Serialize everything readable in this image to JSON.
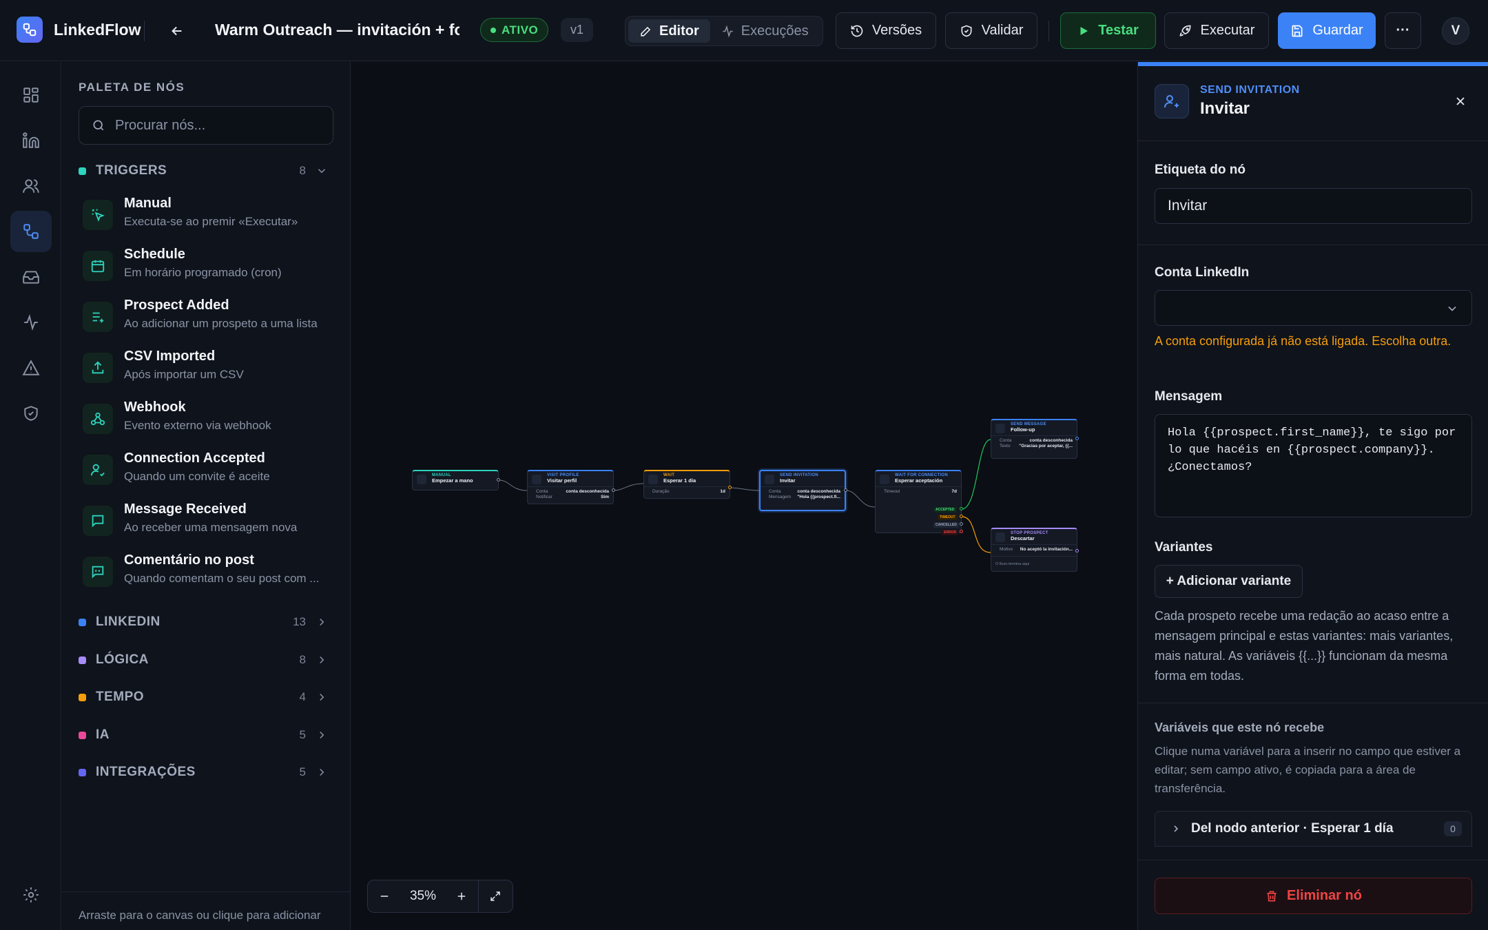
{
  "app": {
    "name": "LinkedFlow"
  },
  "workflow": {
    "title": "Warm Outreach — invitación + follow-up",
    "status": "ATIVO",
    "version": "v1"
  },
  "tabs": [
    {
      "label": "Editor"
    },
    {
      "label": "Execuções"
    }
  ],
  "toolbar": {
    "versions": "Versões",
    "validate": "Validar",
    "test": "Testar",
    "run": "Executar",
    "save": "Guardar",
    "more": "···",
    "avatar": "V"
  },
  "palette": {
    "title": "PALETA DE NÓS",
    "search_placeholder": "Procurar nós...",
    "footer": "Arraste para o canvas ou clique para adicionar",
    "categories": [
      {
        "name": "TRIGGERS",
        "count": "8",
        "color": "#2dd4bf"
      },
      {
        "name": "LINKEDIN",
        "count": "13",
        "color": "#3b82f6"
      },
      {
        "name": "LÓGICA",
        "count": "8",
        "color": "#a78bfa"
      },
      {
        "name": "TEMPO",
        "count": "4",
        "color": "#f59e0b"
      },
      {
        "name": "IA",
        "count": "5",
        "color": "#ec4899"
      },
      {
        "name": "INTEGRAÇÕES",
        "count": "5",
        "color": "#6366f1"
      }
    ],
    "triggers": [
      {
        "title": "Manual",
        "sub": "Executa-se ao premir «Executar»",
        "icon": "pointer-click-icon"
      },
      {
        "title": "Schedule",
        "sub": "Em horário programado (cron)",
        "icon": "calendar-icon"
      },
      {
        "title": "Prospect Added",
        "sub": "Ao adicionar um prospeto a uma lista",
        "icon": "list-plus-icon"
      },
      {
        "title": "CSV Imported",
        "sub": "Após importar um CSV",
        "icon": "upload-icon"
      },
      {
        "title": "Webhook",
        "sub": "Evento externo via webhook",
        "icon": "webhook-icon"
      },
      {
        "title": "Connection Accepted",
        "sub": "Quando um convite é aceite",
        "icon": "user-check-icon"
      },
      {
        "title": "Message Received",
        "sub": "Ao receber uma mensagem nova",
        "icon": "message-icon"
      },
      {
        "title": "Comentário no post",
        "sub": "Quando comentam o seu post com ...",
        "icon": "comment-icon"
      }
    ]
  },
  "canvas": {
    "zoom": "35%",
    "nodes": [
      {
        "type": "MANUAL",
        "label": "Empezar a mano",
        "color": "#2dd4bf"
      },
      {
        "type": "VISIT PROFILE",
        "label": "Visitar perfil",
        "color": "#3b82f6",
        "rows": [
          [
            "Conta",
            "conta desconhecida"
          ],
          [
            "Notificar",
            "Sim"
          ]
        ]
      },
      {
        "type": "WAIT",
        "label": "Esperar 1 día",
        "color": "#f59e0b",
        "rows": [
          [
            "Duração",
            "1d"
          ]
        ]
      },
      {
        "type": "SEND INVITATION",
        "label": "Invitar",
        "color": "#3b82f6",
        "rows": [
          [
            "Conta",
            "conta desconhecida"
          ],
          [
            "Mensagem",
            "\"Hola {{prospect.fi..."
          ]
        ]
      },
      {
        "type": "WAIT FOR CONNECTION",
        "label": "Esperar aceptación",
        "color": "#3b82f6",
        "rows": [
          [
            "Timeout",
            "7d"
          ]
        ],
        "outputs": [
          "ACCEPTED",
          "TIMEOUT",
          "CANCELLED",
          "ERROR"
        ]
      },
      {
        "type": "SEND MESSAGE",
        "label": "Follow-up",
        "color": "#3b82f6",
        "rows": [
          [
            "Conta",
            "conta desconhecida"
          ],
          [
            "Texto",
            "\"Gracias por aceptar, {{..."
          ]
        ]
      },
      {
        "type": "STOP PROSPECT",
        "label": "Descartar",
        "color": "#a78bfa",
        "rows": [
          [
            "Motivo",
            "No aceptó la invitación..."
          ]
        ],
        "note": "O fluxo termina aqui"
      }
    ]
  },
  "panel": {
    "kind": "SEND INVITATION",
    "title": "Invitar",
    "label_field": {
      "label": "Etiqueta do nó",
      "value": "Invitar"
    },
    "account": {
      "label": "Conta LinkedIn",
      "value": "",
      "warning": "A conta configurada já não está ligada. Escolha outra."
    },
    "message": {
      "label": "Mensagem",
      "value": "Hola {{prospect.first_name}}, te sigo por lo que hacéis en {{prospect.company}}. ¿Conectamos?"
    },
    "variants": {
      "label": "Variantes",
      "add": "+ Adicionar variante",
      "help": "Cada prospeto recebe uma redação ao acaso entre a mensagem principal e estas variantes: mais variantes, mais natural. As variáveis {{...}} funcionam da mesma forma em todas."
    },
    "vars": {
      "title": "Variáveis que este nó recebe",
      "help": "Clique numa variável para a inserir no campo que estiver a editar; sem campo ativo, é copiada para a área de transferência.",
      "accordion": "Del nodo anterior · Esperar 1 día",
      "count": "0"
    },
    "delete": "Eliminar nó"
  },
  "colors": {
    "accent": "#3b82f6",
    "success": "#4ade80",
    "warning": "#f59e0b",
    "danger": "#ef4444"
  }
}
